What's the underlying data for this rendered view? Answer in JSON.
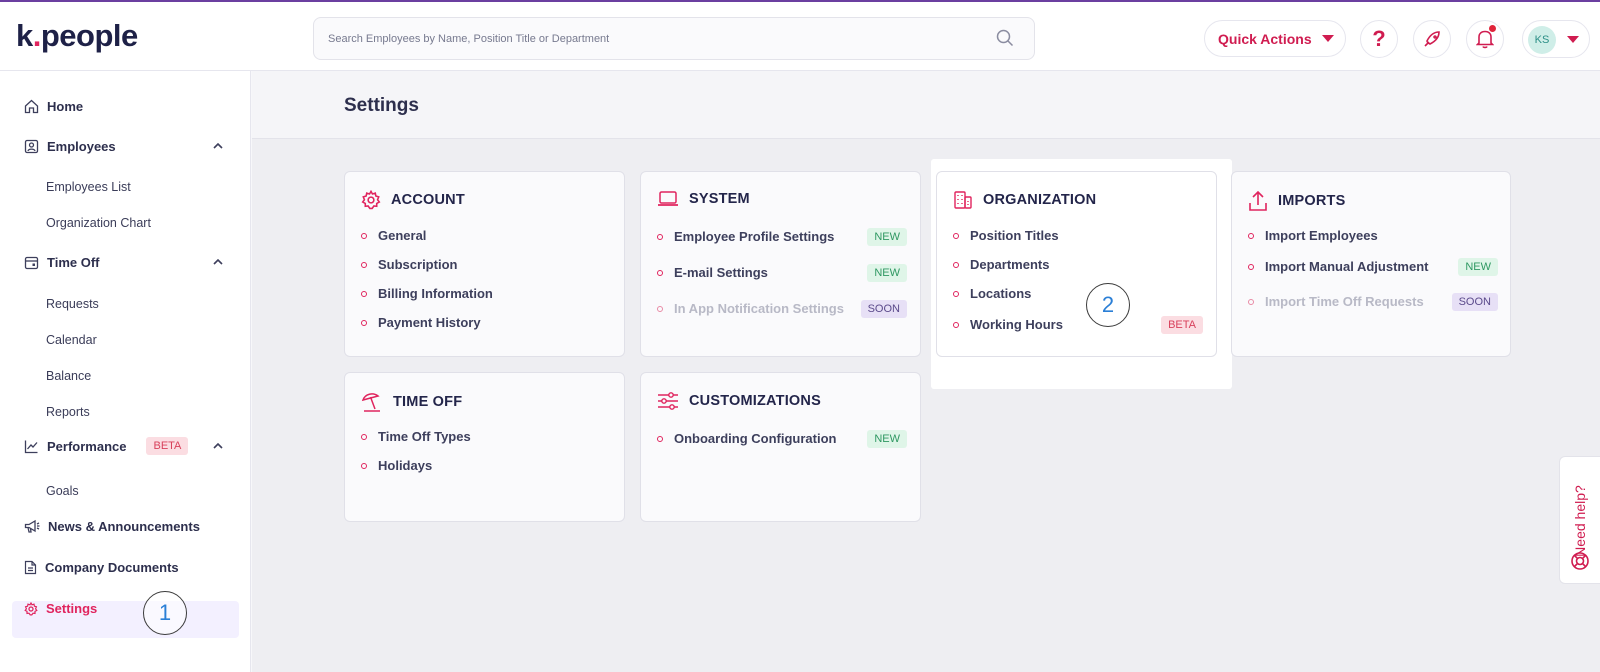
{
  "app": {
    "logo_left": "k",
    "logo_dot": ".",
    "logo_right": "people"
  },
  "search": {
    "placeholder": "Search Employees by Name, Position Title or Department"
  },
  "topbar": {
    "quick_actions": "Quick Actions",
    "avatar_initials": "KS"
  },
  "sidebar": {
    "home": "Home",
    "employees": "Employees",
    "employees_list": "Employees List",
    "org_chart": "Organization Chart",
    "time_off": "Time Off",
    "requests": "Requests",
    "calendar": "Calendar",
    "balance": "Balance",
    "reports": "Reports",
    "performance": "Performance",
    "performance_badge": "BETA",
    "goals": "Goals",
    "news": "News & Announcements",
    "company_documents": "Company Documents",
    "settings": "Settings"
  },
  "page": {
    "title": "Settings"
  },
  "cards": {
    "account": {
      "title": "ACCOUNT",
      "items": [
        "General",
        "Subscription",
        "Billing Information",
        "Payment History"
      ]
    },
    "system": {
      "title": "SYSTEM",
      "items": [
        {
          "label": "Employee Profile Settings",
          "badge": "NEW"
        },
        {
          "label": "E-mail Settings",
          "badge": "NEW"
        },
        {
          "label": "In App Notification Settings",
          "badge": "SOON"
        }
      ]
    },
    "organization": {
      "title": "ORGANIZATION",
      "items": [
        {
          "label": "Position Titles"
        },
        {
          "label": "Departments"
        },
        {
          "label": "Locations"
        },
        {
          "label": "Working Hours",
          "badge": "BETA"
        }
      ]
    },
    "imports": {
      "title": "IMPORTS",
      "items": [
        {
          "label": "Import Employees"
        },
        {
          "label": "Import Manual Adjustment",
          "badge": "NEW"
        },
        {
          "label": "Import Time Off Requests",
          "badge": "SOON"
        }
      ]
    },
    "time_off": {
      "title": "TIME OFF",
      "items": [
        "Time Off Types",
        "Holidays"
      ]
    },
    "customizations": {
      "title": "CUSTOMIZATIONS",
      "items": [
        {
          "label": "Onboarding Configuration",
          "badge": "NEW"
        }
      ]
    }
  },
  "steps": {
    "one": "1",
    "two": "2"
  },
  "help": {
    "label": "Need help?"
  },
  "colors": {
    "accent": "#e0245e",
    "brand_dark": "#1e2147"
  }
}
